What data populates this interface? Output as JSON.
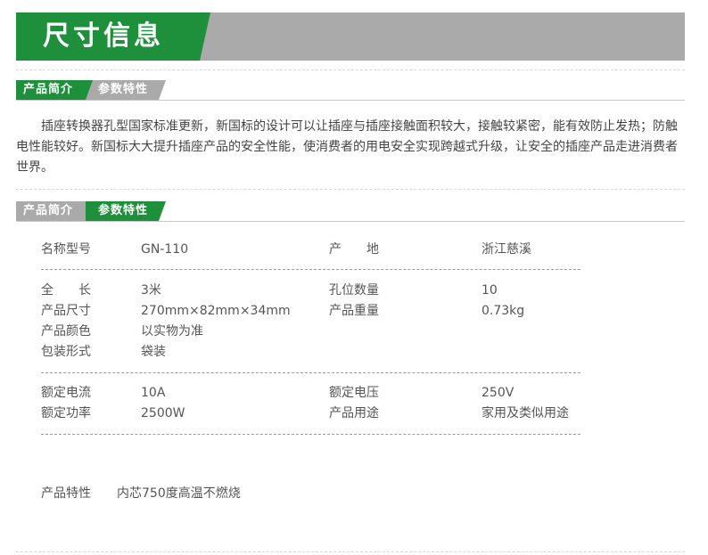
{
  "banner": {
    "title": "尺寸信息"
  },
  "tabs_1": {
    "intro_tab": "产品简介",
    "params_tab": "参数特性"
  },
  "intro_text": "插座转换器孔型国家标准更新，新国标的设计可以让插座与插座接触面积较大，接触较紧密，能有效防止发热；防触电性能较好。新国标大大提升插座产品的安全性能，使消费者的用电安全实现跨越式升级，让安全的插座产品走进消费者世界。",
  "tabs_2": {
    "intro_tab": "产品简介",
    "params_tab": "参数特性"
  },
  "specs": {
    "group1": [
      {
        "label": "名称型号",
        "value": "GN-110",
        "label2": "产　　地",
        "value2": "浙江慈溪"
      }
    ],
    "group2": [
      {
        "label": "全　　长",
        "value": "3米",
        "label2": "孔位数量",
        "value2": "10"
      },
      {
        "label": "产品尺寸",
        "value": "270mm×82mm×34mm",
        "label2": "产品重量",
        "value2": "0.73kg"
      },
      {
        "label": "产品颜色",
        "value": "以实物为准"
      },
      {
        "label": "包装形式",
        "value": "袋装"
      }
    ],
    "group3": [
      {
        "label": "额定电流",
        "value": "10A",
        "label2": "额定电压",
        "value2": "250V"
      },
      {
        "label": "额定功率",
        "value": "2500W",
        "label2": "产品用途",
        "value2": "家用及类似用途"
      }
    ],
    "feature": {
      "label": "产品特性",
      "value": "内芯750度高温不燃烧"
    }
  },
  "colors": {
    "brand_green": "#1e8f3b",
    "tab_gray": "#aaaaaa"
  }
}
